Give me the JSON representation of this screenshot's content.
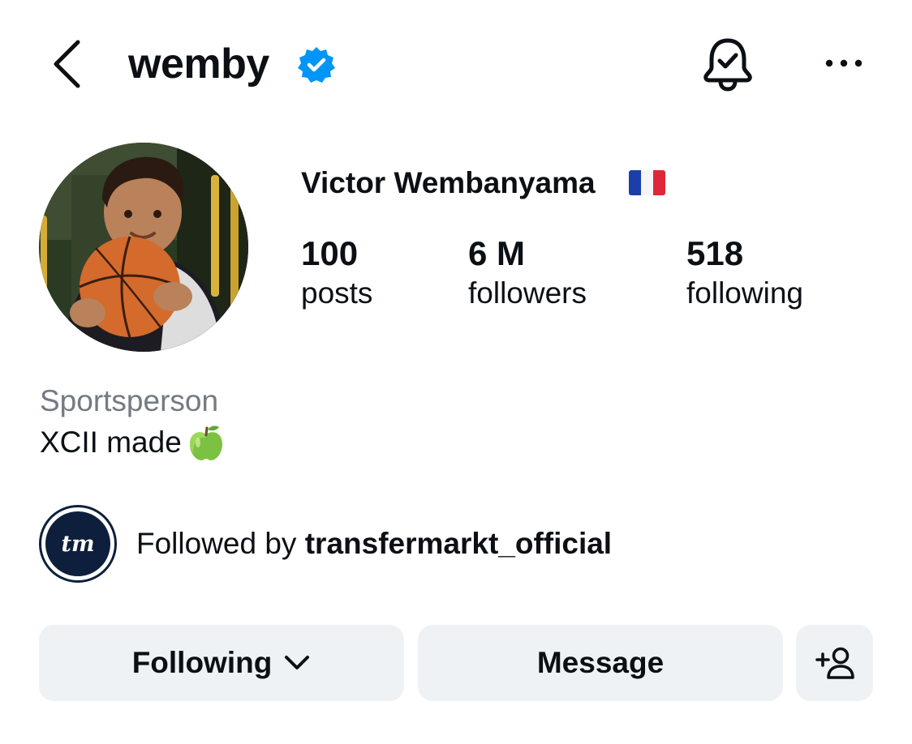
{
  "header": {
    "username": "wemby",
    "back_icon": "chevron-left-icon",
    "verified_icon": "verified-badge-icon",
    "notifications_icon": "bell-check-icon",
    "more_icon": "more-horizontal-icon"
  },
  "profile": {
    "full_name": "Victor Wembanyama",
    "flag_icon": "france-flag-icon",
    "stats": [
      {
        "value": "100",
        "label": "posts"
      },
      {
        "value": "6 M",
        "label": "followers"
      },
      {
        "value": "518",
        "label": "following"
      }
    ],
    "category": "Sportsperson",
    "bio_text": "XCII made",
    "bio_icon": "green-apple-icon"
  },
  "followed_by": {
    "avatar_text": "tm",
    "prefix": "Followed by ",
    "account": "transfermarkt_official"
  },
  "actions": {
    "following_label": "Following",
    "message_label": "Message",
    "add_user_icon": "add-person-icon"
  },
  "colors": {
    "text": "#0c1014",
    "secondary_text": "#737a82",
    "verified": "#0095f6",
    "button_bg": "#eff2f5",
    "tm_navy": "#0d1f3c"
  }
}
